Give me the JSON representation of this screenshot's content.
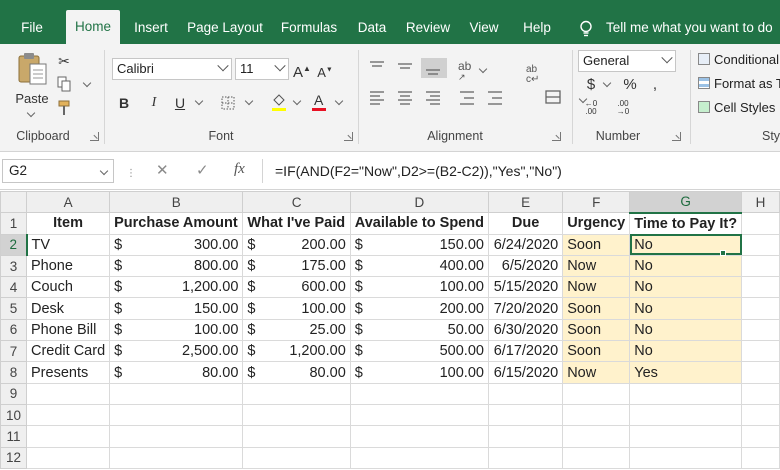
{
  "ribbon_tabs": [
    "File",
    "Home",
    "Insert",
    "Page Layout",
    "Formulas",
    "Data",
    "Review",
    "View",
    "Help"
  ],
  "tell_me": "Tell me what you want to do",
  "clipboard": {
    "paste_label": "Paste",
    "group_label": "Clipboard"
  },
  "font": {
    "family": "Calibri",
    "size": "11",
    "group_label": "Font"
  },
  "alignment": {
    "group_label": "Alignment"
  },
  "number": {
    "format": "General",
    "group_label": "Number"
  },
  "styles": {
    "conditional": "Conditional",
    "format_as": "Format as T",
    "cell_styles": "Cell Styles",
    "group_label_partial": "Sty"
  },
  "name_box": "G2",
  "formula": "=IF(AND(F2=\"Now\",D2>=(B2-C2)),\"Yes\",\"No\")",
  "columns": [
    "A",
    "B",
    "C",
    "D",
    "E",
    "F",
    "G",
    "H"
  ],
  "headers": [
    "Item",
    "Purchase Amount",
    "What I've Paid",
    "Available to Spend",
    "Due",
    "Urgency",
    "Time to Pay It?"
  ],
  "rows": [
    {
      "item": "TV",
      "purchase": "300.00",
      "paid": "200.00",
      "available": "150.00",
      "due": "6/24/2020",
      "urgency": "Soon",
      "pay": "No"
    },
    {
      "item": "Phone",
      "purchase": "800.00",
      "paid": "175.00",
      "available": "400.00",
      "due": "6/5/2020",
      "urgency": "Now",
      "pay": "No"
    },
    {
      "item": "Couch",
      "purchase": "1,200.00",
      "paid": "600.00",
      "available": "100.00",
      "due": "5/15/2020",
      "urgency": "Now",
      "pay": "No"
    },
    {
      "item": "Desk",
      "purchase": "150.00",
      "paid": "100.00",
      "available": "200.00",
      "due": "7/20/2020",
      "urgency": "Soon",
      "pay": "No"
    },
    {
      "item": "Phone Bill",
      "purchase": "100.00",
      "paid": "25.00",
      "available": "50.00",
      "due": "6/30/2020",
      "urgency": "Soon",
      "pay": "No"
    },
    {
      "item": "Credit Card",
      "purchase": "2,500.00",
      "paid": "1,200.00",
      "available": "500.00",
      "due": "6/17/2020",
      "urgency": "Soon",
      "pay": "No"
    },
    {
      "item": "Presents",
      "purchase": "80.00",
      "paid": "80.00",
      "available": "100.00",
      "due": "6/15/2020",
      "urgency": "Now",
      "pay": "Yes"
    }
  ],
  "currency_symbol": "$",
  "row_numbers": [
    "1",
    "2",
    "3",
    "4",
    "5",
    "6",
    "7",
    "8",
    "9",
    "10",
    "11",
    "12"
  ],
  "colors": {
    "brand_green": "#217346",
    "highlight_fill": "#fff2cc"
  }
}
